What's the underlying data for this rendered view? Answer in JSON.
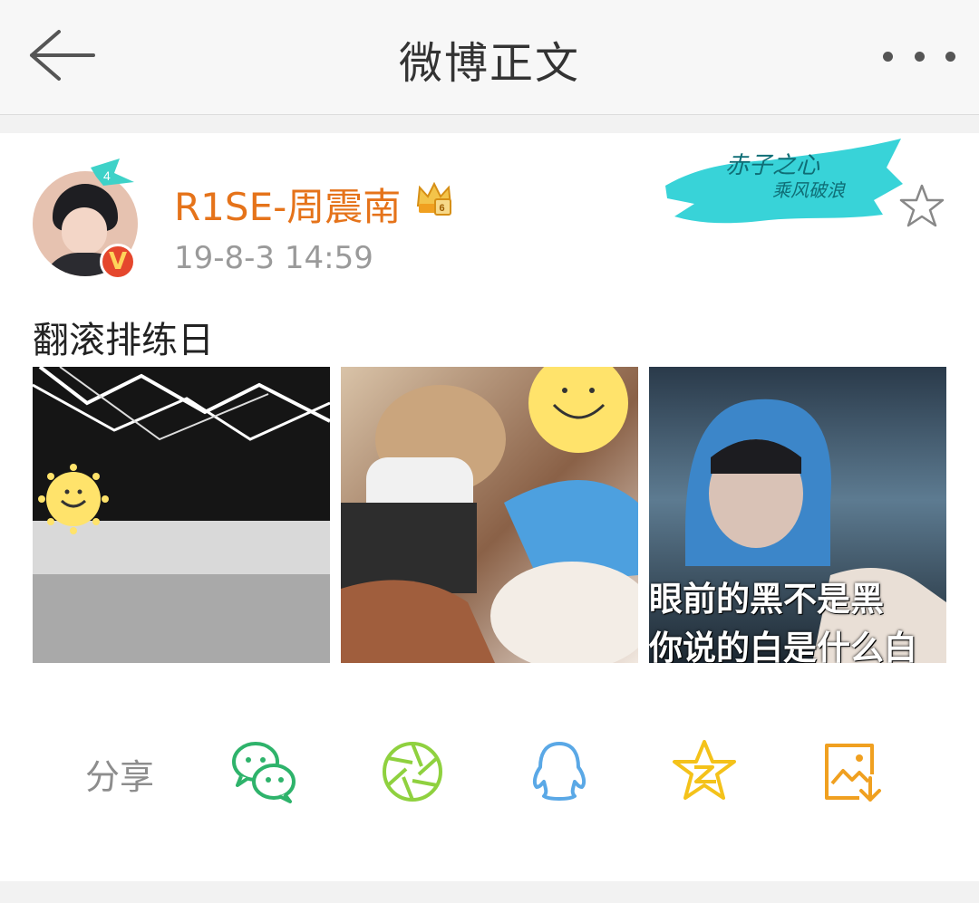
{
  "header": {
    "title": "微博正文"
  },
  "post": {
    "username": "R1SE-周震南",
    "timestamp": "19-8-3 14:59",
    "content": "翻滚排练日",
    "verified_badge": "V",
    "banner_text_1": "赤子之心",
    "banner_text_2": "乘风破浪",
    "photos": [
      {
        "alt": "rehearsal room"
      },
      {
        "alt": "selfie"
      },
      {
        "alt": "meme",
        "caption_line1": "眼前的黑不是黑",
        "caption_line2": "你说的白是什么白"
      }
    ]
  },
  "share": {
    "label": "分享",
    "icons": [
      "wechat-icon",
      "moments-icon",
      "qq-icon",
      "qzone-icon",
      "save-image-icon"
    ]
  },
  "colors": {
    "accent_orange": "#e5731a",
    "wechat_green": "#2eb36b",
    "moments_green": "#8fd13f",
    "qq_blue": "#5aa8e6",
    "qzone_yellow": "#f4c21a",
    "save_orange": "#f0a020"
  }
}
